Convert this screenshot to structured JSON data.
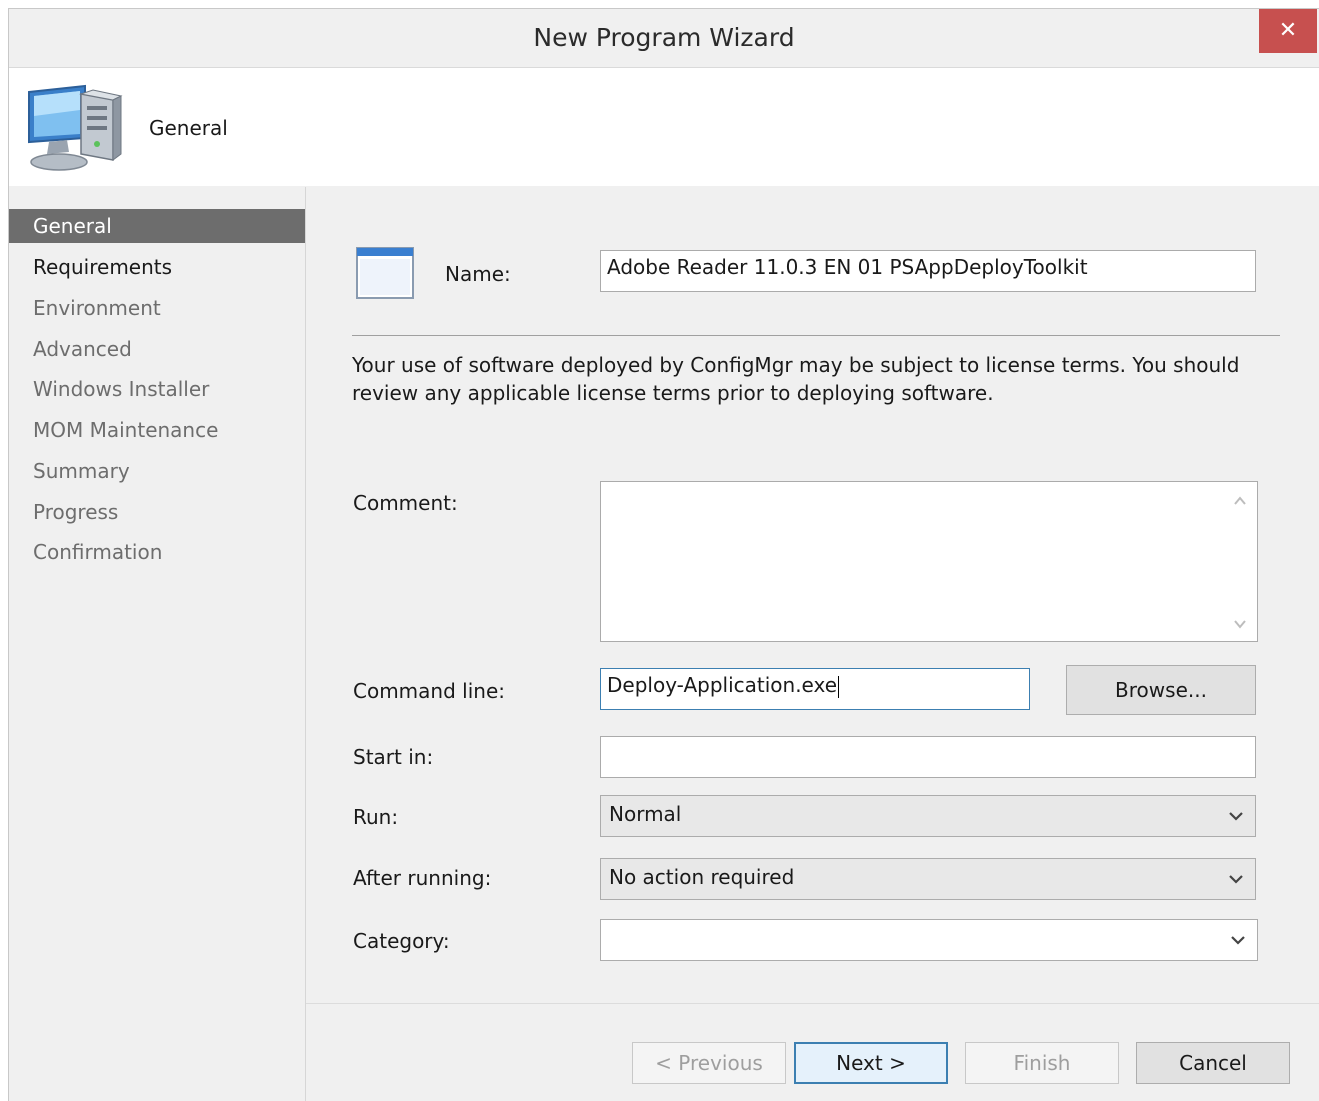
{
  "window": {
    "title": "New Program Wizard",
    "close_glyph": "✕"
  },
  "header": {
    "page_title": "General",
    "icon": "computer-icon"
  },
  "nav": {
    "items": [
      {
        "label": "General",
        "state": "active"
      },
      {
        "label": "Requirements",
        "state": "normal"
      },
      {
        "label": "Environment",
        "state": "disabled"
      },
      {
        "label": "Advanced",
        "state": "disabled"
      },
      {
        "label": "Windows Installer",
        "state": "disabled"
      },
      {
        "label": "MOM Maintenance",
        "state": "disabled"
      },
      {
        "label": "Summary",
        "state": "disabled"
      },
      {
        "label": "Progress",
        "state": "disabled"
      },
      {
        "label": "Confirmation",
        "state": "disabled"
      }
    ]
  },
  "form": {
    "name_label": "Name:",
    "name_value": "Adobe Reader 11.0.3 EN 01 PSAppDeployToolkit",
    "license_text": "Your use of software deployed by ConfigMgr may be subject to license terms. You should review any applicable license terms prior to deploying software.",
    "comment_label": "Comment:",
    "comment_value": "",
    "command_label": "Command line:",
    "command_value": "Deploy-Application.exe",
    "browse_label": "Browse...",
    "startin_label": "Start in:",
    "startin_value": "",
    "run_label": "Run:",
    "run_value": "Normal",
    "after_label": "After running:",
    "after_value": "No action required",
    "category_label": "Category:",
    "category_value": ""
  },
  "footer": {
    "previous_label": "< Previous",
    "next_label": "Next >",
    "finish_label": "Finish",
    "cancel_label": "Cancel"
  },
  "colors": {
    "close_bg": "#c7504f",
    "nav_active_bg": "#6d6d6d",
    "focus_border": "#3c7fb1"
  }
}
